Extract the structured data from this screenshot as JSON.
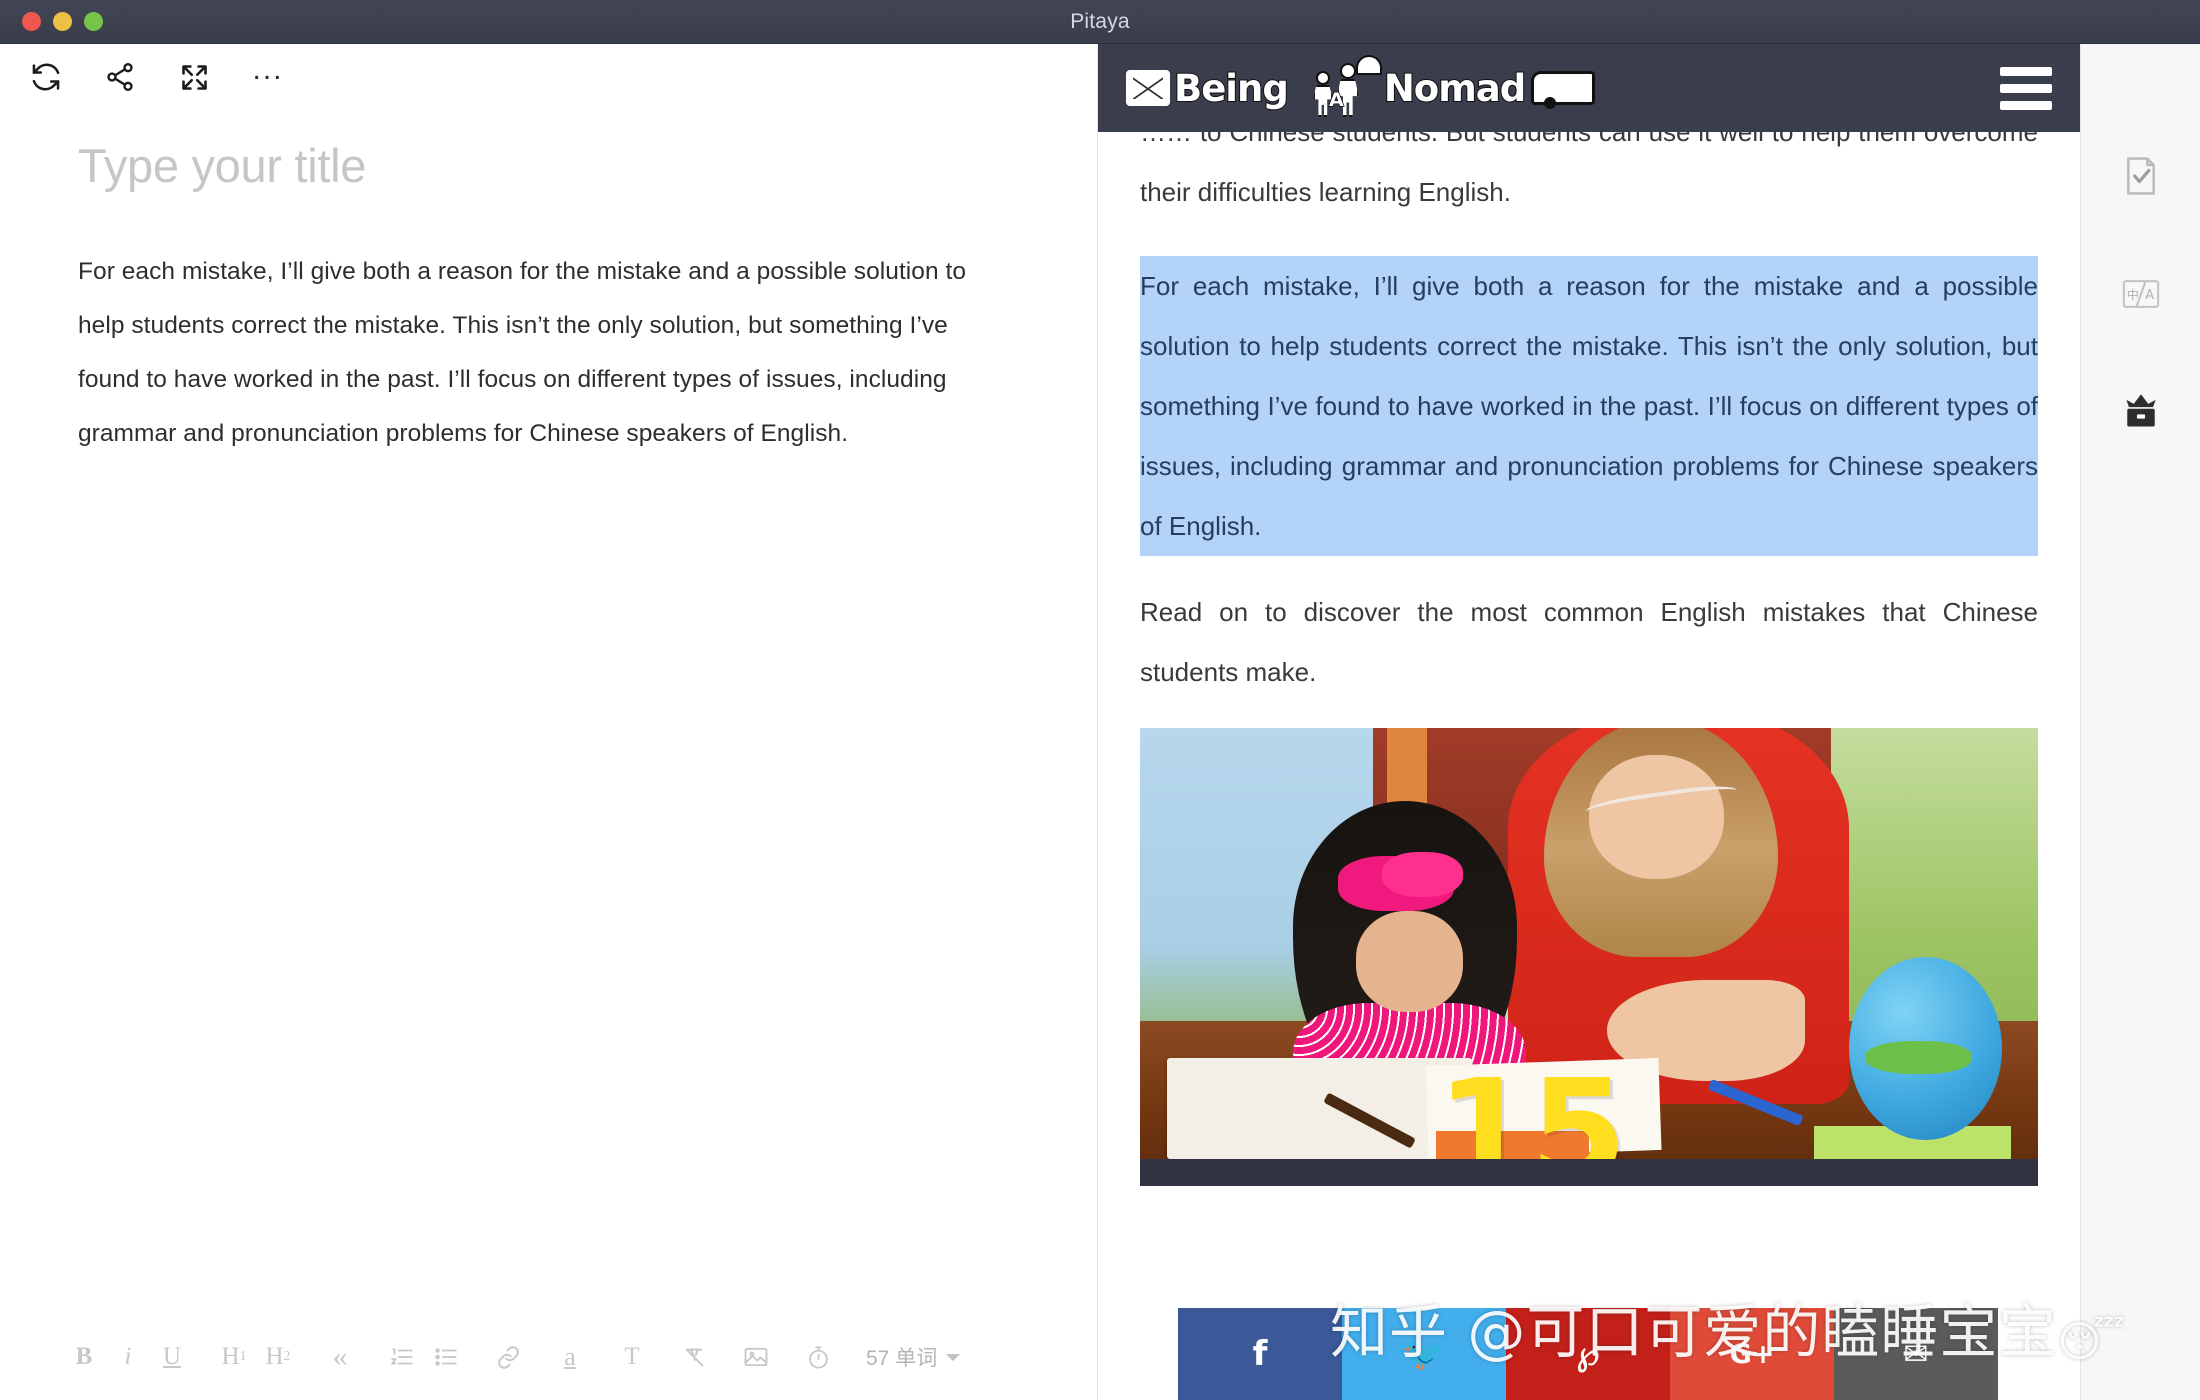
{
  "window": {
    "title": "Pitaya",
    "traffic_lights": [
      "close-red",
      "minimize-yellow",
      "zoom-green"
    ]
  },
  "editor": {
    "toolbar": {
      "refresh_label": "refresh-icon",
      "share_label": "share-icon",
      "fullscreen_label": "fullscreen-icon",
      "more_label": "..."
    },
    "title_placeholder": "Type your title",
    "body": "For each mistake, I’ll give both a reason for the mistake and a possible solution to help students correct the mistake. This isn’t the only solution, but something I’ve found to have worked in the past. I’ll focus on different types of issues, including grammar and pronunciation problems for Chinese speakers of English.",
    "format_bar": {
      "bold": "B",
      "italic": "i",
      "underline": "U",
      "heading1": "H",
      "heading1_sub": "1",
      "heading2": "H",
      "heading2_sub": "2",
      "quote": "«",
      "ordered_list": "ordered-list-icon",
      "unordered_list": "unordered-list-icon",
      "link": "link-icon",
      "highlight": "a",
      "text_style": "T",
      "clear_format": "clear-format-icon",
      "image": "image-icon",
      "timer": "timer-icon"
    },
    "word_count": "57 单词"
  },
  "preview": {
    "site_logo": {
      "text_1": "Being",
      "text_2": "A",
      "text_3": "Nomad"
    },
    "menu_label": "hamburger-menu-icon",
    "paragraphs": [
      {
        "id": "p-intro",
        "text": "…… to Chinese students. But students can use it well to help them overcome their difficulties learning English.",
        "selected": false
      },
      {
        "id": "p-selected",
        "text": "For each mistake, I’ll give both a reason for the mistake and a possible solution to help students correct the mistake. This isn’t the only solution, but something I’ve found to have worked in the past. I’ll focus on different types of issues, including grammar and pronunciation problems for Chinese speakers of English.",
        "selected": true
      },
      {
        "id": "p-readon",
        "text": "Read on to discover the most common English mistakes that Chinese students make.",
        "selected": false
      }
    ],
    "figure": {
      "caption_number": "15",
      "alt": "teacher-helping-student-photo"
    },
    "social_buttons": [
      {
        "name": "facebook",
        "glyph": "f",
        "color": "#3b5998"
      },
      {
        "name": "twitter",
        "glyph": "🐦",
        "color": "#42aeec"
      },
      {
        "name": "pinterest",
        "glyph": "℘",
        "color": "#c3201a"
      },
      {
        "name": "googleplus",
        "glyph": "G+",
        "color": "#e04b39"
      },
      {
        "name": "email",
        "glyph": "✉",
        "color": "#5b5b5b"
      }
    ]
  },
  "watermark": {
    "text": "知乎 @可口可爱的瞌睡宝宝",
    "emoji": "😴"
  },
  "right_rail": {
    "items": [
      {
        "name": "document-check-icon",
        "label": "proofread"
      },
      {
        "name": "translate-icon",
        "label": "中/A"
      },
      {
        "name": "archive-box-icon",
        "label": "archive"
      }
    ]
  }
}
